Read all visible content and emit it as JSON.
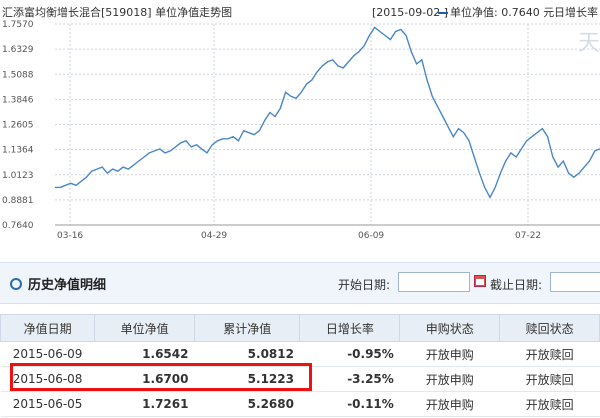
{
  "chart_header": {
    "fund_title": "汇添富均衡增长混合[519018] 单位净值走势图",
    "date_bracket": "[2015-09-02 ]",
    "legend_label": "单位净值: 0.7640 元",
    "extra_label": "日增长率",
    "watermark": "天"
  },
  "chart_data": {
    "type": "line",
    "x_tick_labels": [
      "03-16",
      "04-29",
      "06-09",
      "07-22"
    ],
    "y_tick_labels": [
      "1.7570",
      "1.6329",
      "1.5088",
      "1.3846",
      "1.2605",
      "1.1364",
      "1.0123",
      "0.8881",
      "0.7640"
    ],
    "ylim": [
      0.764,
      1.757
    ],
    "grid": true,
    "series": [
      {
        "name": "单位净值",
        "color": "#4a86c8",
        "values": [
          0.95,
          0.95,
          0.96,
          0.97,
          0.96,
          0.98,
          1.0,
          1.03,
          1.04,
          1.05,
          1.02,
          1.04,
          1.03,
          1.05,
          1.04,
          1.06,
          1.08,
          1.1,
          1.12,
          1.13,
          1.14,
          1.12,
          1.13,
          1.15,
          1.17,
          1.18,
          1.15,
          1.16,
          1.14,
          1.12,
          1.16,
          1.18,
          1.19,
          1.19,
          1.2,
          1.18,
          1.23,
          1.22,
          1.21,
          1.23,
          1.28,
          1.32,
          1.3,
          1.34,
          1.42,
          1.4,
          1.39,
          1.42,
          1.46,
          1.48,
          1.52,
          1.55,
          1.57,
          1.58,
          1.55,
          1.54,
          1.57,
          1.6,
          1.62,
          1.65,
          1.7,
          1.74,
          1.72,
          1.7,
          1.68,
          1.72,
          1.73,
          1.7,
          1.62,
          1.56,
          1.58,
          1.48,
          1.4,
          1.35,
          1.3,
          1.25,
          1.2,
          1.24,
          1.22,
          1.18,
          1.1,
          1.02,
          0.95,
          0.9,
          0.95,
          1.02,
          1.08,
          1.12,
          1.1,
          1.14,
          1.18,
          1.2,
          1.22,
          1.24,
          1.2,
          1.1,
          1.05,
          1.08,
          1.02,
          1.0,
          1.02,
          1.05,
          1.08,
          1.13,
          1.14
        ]
      }
    ]
  },
  "history_panel": {
    "title": "历史净值明细",
    "start_date_label": "开始日期:",
    "end_date_label": "截止日期:",
    "start_value": "",
    "end_value": ""
  },
  "table": {
    "headers": [
      "净值日期",
      "单位净值",
      "累计净值",
      "日增长率",
      "申购状态",
      "赎回状态"
    ],
    "rows": [
      {
        "date": "2015-06-09",
        "nav": "1.6542",
        "cum": "5.0812",
        "pct": "-0.95%",
        "buy": "开放申购",
        "sell": "开放赎回"
      },
      {
        "date": "2015-06-08",
        "nav": "1.6700",
        "cum": "5.1223",
        "pct": "-3.25%",
        "buy": "开放申购",
        "sell": "开放赎回"
      },
      {
        "date": "2015-06-05",
        "nav": "1.7261",
        "cum": "5.2680",
        "pct": "-0.11%",
        "buy": "开放申购",
        "sell": "开放赎回"
      }
    ]
  }
}
